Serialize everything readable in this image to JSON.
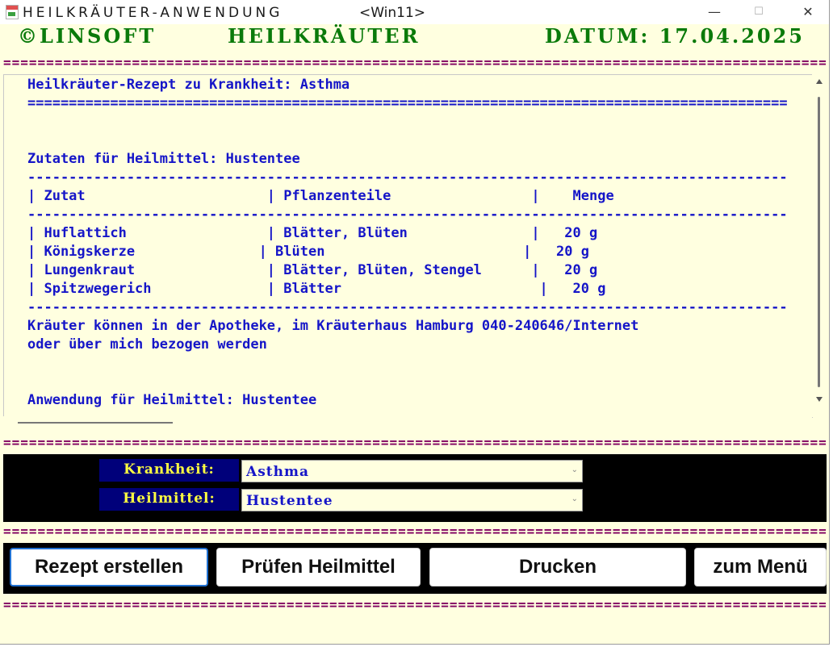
{
  "window": {
    "title": "HEILKRÄUTER-ANWENDUNG",
    "env_tag": "<Win11>",
    "minimize_glyph": "—",
    "maximize_glyph": "☐",
    "close_glyph": "✕"
  },
  "header": {
    "left": "©LINSOFT",
    "center": "HEILKRÄUTER",
    "right": "DATUM: 17.04.2025"
  },
  "separator": "==========================================================================================================================",
  "text_area": {
    "lines": [
      "Heilkräuter-Rezept zu Krankheit: Asthma",
      "============================================================================================",
      "",
      "",
      "Zutaten für Heilmittel: Hustentee",
      "--------------------------------------------------------------------------------------------",
      "| Zutat                      | Pflanzenteile                 |    Menge",
      "--------------------------------------------------------------------------------------------",
      "",
      "| Huflattich                 | Blätter, Blüten               |   20 g",
      "| Königskerze               | Blüten                        |   20 g",
      "| Lungenkraut                | Blätter, Blüten, Stengel      |   20 g",
      "| Spitzwegerich              | Blätter                        |   20 g",
      "--------------------------------------------------------------------------------------------",
      "Kräuter können in der Apotheke, im Kräuterhaus Hamburg 040-240646/Internet",
      "oder über mich bezogen werden",
      "",
      "",
      "Anwendung für Heilmittel: Hustentee"
    ]
  },
  "form": {
    "krankheit_label": "Krankheit:",
    "krankheit_value": "Asthma",
    "heilmittel_label": "Heilmittel:",
    "heilmittel_value": "Hustentee",
    "chevron": "⌄"
  },
  "buttons": {
    "rezept": "Rezept erstellen",
    "pruefen": "Prüfen Heilmittel",
    "drucken": "Drucken",
    "menu": "zum Menü"
  },
  "colors": {
    "background": "#ffffe0",
    "header_green": "#0a7a0a",
    "text_blue": "#1515c8",
    "separator_purple": "#800060",
    "label_bg": "#00007a",
    "label_fg": "#ffff40"
  }
}
